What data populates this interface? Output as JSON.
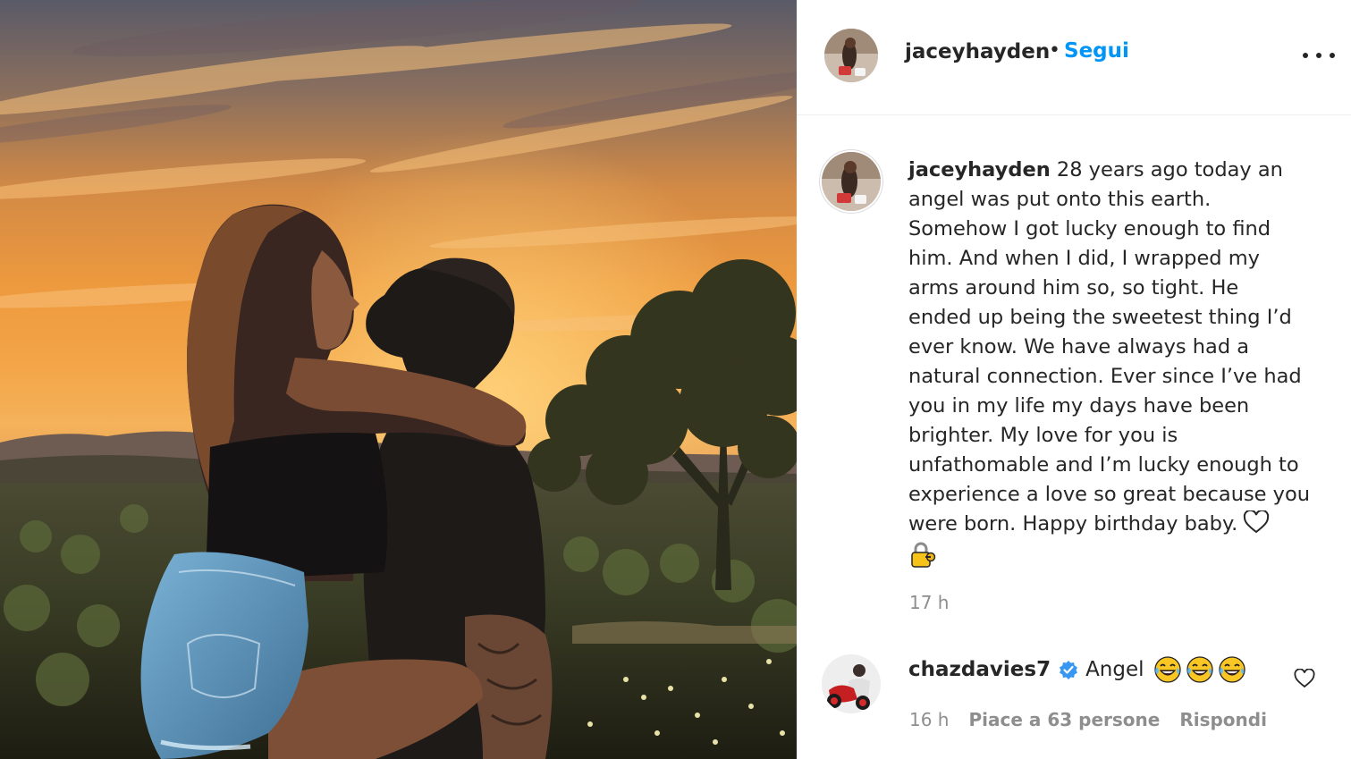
{
  "post": {
    "username": "jaceyhayden",
    "separator": "•",
    "follow_label": "Segui",
    "more_icon": "more-options-icon"
  },
  "caption": {
    "username": "jaceyhayden",
    "lines": [
      "28 years ago today an",
      "angel was put onto this earth.",
      "Somehow I got lucky enough to find",
      "him. And when I did, I wrapped my",
      "arms around him so, so tight. He",
      "ended up being the sweetest thing I’d",
      "ever know. We have always had a",
      "natural connection. Ever since I’ve had",
      "you in my life my days have been",
      "brighter. My love for you is",
      "unfathomable and I’m lucky enough to",
      "experience a love so great because you",
      "were born. Happy birthday baby."
    ],
    "heart_icon": "white-heart-icon",
    "emoji_icon": "locked-with-key-emoji",
    "time": "17 h"
  },
  "comment": {
    "username": "chazdavies7",
    "verified_icon": "verified-badge-icon",
    "text": "Angel",
    "emoji_icon": "tears-of-joy-emoji",
    "emoji_count": 3,
    "time": "16 h",
    "likes_label": "Piace a 63 persone",
    "reply_label": "Rispondi",
    "like_icon": "heart-outline-icon"
  },
  "colors": {
    "link_blue": "#0095f6",
    "muted_text": "#8e8e8e",
    "text": "#262626",
    "verified": "#3897f0",
    "sky_orange": "#f0a040"
  }
}
